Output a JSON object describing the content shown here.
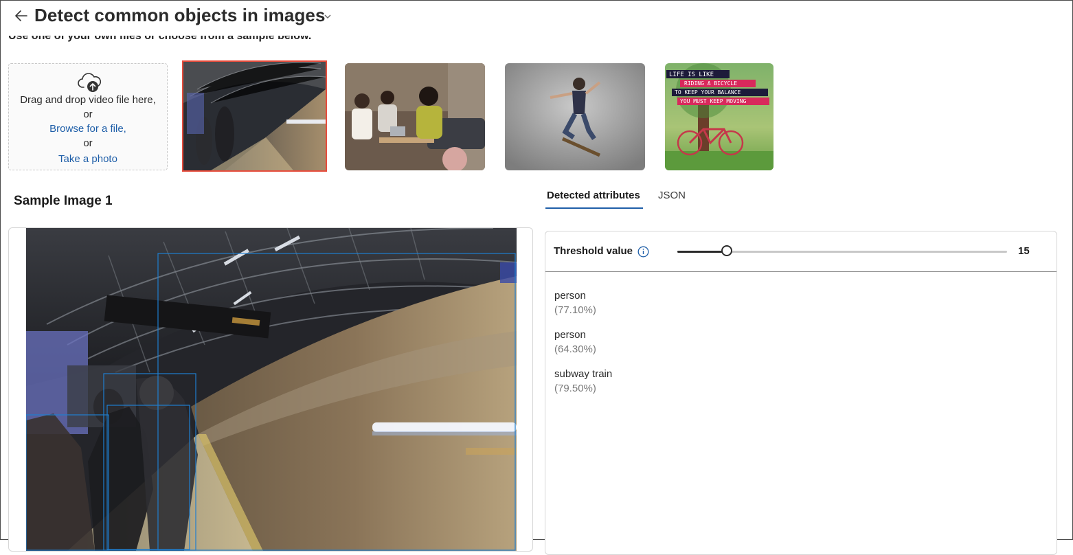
{
  "header": {
    "title": "Detect common objects in images",
    "instruction": "Use one of your own files or choose from a sample below."
  },
  "upload": {
    "line1": "Drag and drop video file here,",
    "or1": "or",
    "browse_link": "Browse for a file,",
    "or2": "or",
    "photo_link": "Take a photo"
  },
  "samples": {
    "items": [
      {
        "name": "subway-platform",
        "selected": true
      },
      {
        "name": "people-meeting-on-couch",
        "selected": false
      },
      {
        "name": "skateboarder-jumping",
        "selected": false
      },
      {
        "name": "life-is-like-riding-a-bicycle",
        "selected": false,
        "poster_text": [
          "LIFE IS LIKE",
          "RIDING A BICYCLE",
          "TO KEEP YOUR BALANCE",
          "YOU MUST KEEP MOVING"
        ]
      }
    ]
  },
  "sample_title": "Sample Image 1",
  "tabs": [
    {
      "label": "Detected attributes",
      "active": true
    },
    {
      "label": "JSON",
      "active": false
    }
  ],
  "threshold": {
    "label": "Threshold value",
    "value": "15",
    "fraction": 0.15
  },
  "results": [
    {
      "object": "person",
      "confidence": "(77.10%)"
    },
    {
      "object": "person",
      "confidence": "(64.30%)"
    },
    {
      "object": "subway train",
      "confidence": "(79.50%)"
    }
  ],
  "colors": {
    "link": "#1e5ea8",
    "selected_border": "#e74c3c",
    "bounding_box": "#1e7fd0"
  }
}
